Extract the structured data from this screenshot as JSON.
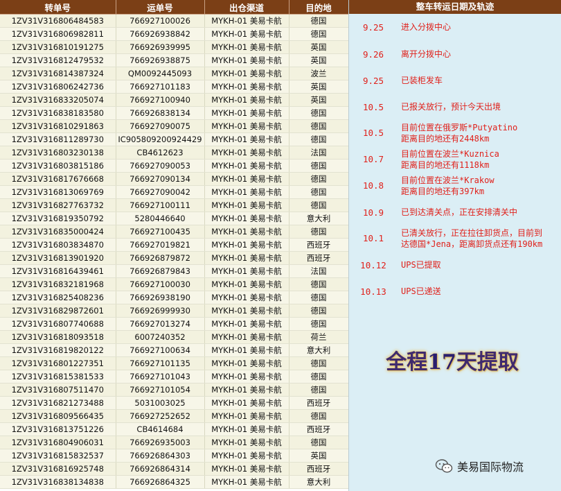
{
  "table": {
    "headers": [
      "转单号",
      "运单号",
      "出仓渠道",
      "目的地"
    ],
    "rows": [
      [
        "1ZV31V316806484583",
        "766927100026",
        "MYKH-01 美易卡航",
        "德国"
      ],
      [
        "1ZV31V316806982811",
        "766926938842",
        "MYKH-01 美易卡航",
        "德国"
      ],
      [
        "1ZV31V316810191275",
        "766926939995",
        "MYKH-01 美易卡航",
        "英国"
      ],
      [
        "1ZV31V316812479532",
        "766926938875",
        "MYKH-01 美易卡航",
        "英国"
      ],
      [
        "1ZV31V316814387324",
        "QM0092445093",
        "MYKH-01 美易卡航",
        "波兰"
      ],
      [
        "1ZV31V316806242736",
        "766927101183",
        "MYKH-01 美易卡航",
        "英国"
      ],
      [
        "1ZV31V316833205074",
        "766927100940",
        "MYKH-01 美易卡航",
        "英国"
      ],
      [
        "1ZV31V316838183580",
        "766926838134",
        "MYKH-01 美易卡航",
        "德国"
      ],
      [
        "1ZV31V316810291863",
        "766927090075",
        "MYKH-01 美易卡航",
        "德国"
      ],
      [
        "1ZV31V316811289730",
        "IC905809200924429",
        "MYKH-01 美易卡航",
        "德国"
      ],
      [
        "1ZV31V316803230138",
        "CB4612623",
        "MYKH-01 美易卡航",
        "法国"
      ],
      [
        "1ZV31V316803815186",
        "766927090053",
        "MYKH-01 美易卡航",
        "德国"
      ],
      [
        "1ZV31V316817676668",
        "766927090134",
        "MYKH-01 美易卡航",
        "德国"
      ],
      [
        "1ZV31V316813069769",
        "766927090042",
        "MYKH-01 美易卡航",
        "德国"
      ],
      [
        "1ZV31V316827763732",
        "766927100111",
        "MYKH-01 美易卡航",
        "德国"
      ],
      [
        "1ZV31V316819350792",
        "5280446640",
        "MYKH-01 美易卡航",
        "意大利"
      ],
      [
        "1ZV31V316835000424",
        "766927100435",
        "MYKH-01 美易卡航",
        "德国"
      ],
      [
        "1ZV31V316803834870",
        "766927019821",
        "MYKH-01 美易卡航",
        "西班牙"
      ],
      [
        "1ZV31V316813901920",
        "766926879872",
        "MYKH-01 美易卡航",
        "西班牙"
      ],
      [
        "1ZV31V316816439461",
        "766926879843",
        "MYKH-01 美易卡航",
        "法国"
      ],
      [
        "1ZV31V316832181968",
        "766927100030",
        "MYKH-01 美易卡航",
        "德国"
      ],
      [
        "1ZV31V316825408236",
        "766926938190",
        "MYKH-01 美易卡航",
        "德国"
      ],
      [
        "1ZV31V316829872601",
        "766926999930",
        "MYKH-01 美易卡航",
        "德国"
      ],
      [
        "1ZV31V316807740688",
        "766927013274",
        "MYKH-01 美易卡航",
        "德国"
      ],
      [
        "1ZV31V316818093518",
        "6007240352",
        "MYKH-01 美易卡航",
        "荷兰"
      ],
      [
        "1ZV31V316819820122",
        "766927100634",
        "MYKH-01 美易卡航",
        "意大利"
      ],
      [
        "1ZV31V316801227351",
        "766927101135",
        "MYKH-01 美易卡航",
        "德国"
      ],
      [
        "1ZV31V316815381533",
        "766927101043",
        "MYKH-01 美易卡航",
        "德国"
      ],
      [
        "1ZV31V316807511470",
        "766927101054",
        "MYKH-01 美易卡航",
        "德国"
      ],
      [
        "1ZV31V316821273488",
        "5031003025",
        "MYKH-01 美易卡航",
        "西班牙"
      ],
      [
        "1ZV31V316809566435",
        "766927252652",
        "MYKH-01 美易卡航",
        "德国"
      ],
      [
        "1ZV31V316813751226",
        "CB4614684",
        "MYKH-01 美易卡航",
        "西班牙"
      ],
      [
        "1ZV31V316804906031",
        "766926935003",
        "MYKH-01 美易卡航",
        "德国"
      ],
      [
        "1ZV31V316815832537",
        "766926864303",
        "MYKH-01 美易卡航",
        "英国"
      ],
      [
        "1ZV31V316816925748",
        "766926864314",
        "MYKH-01 美易卡航",
        "西班牙"
      ],
      [
        "1ZV31V316838134838",
        "766926864325",
        "MYKH-01 美易卡航",
        "意大利"
      ]
    ]
  },
  "tracking": {
    "title": "整车转运日期及轨迹",
    "events": [
      {
        "date": "9.25",
        "lines": [
          "进入分拨中心"
        ]
      },
      {
        "date": "9.26",
        "lines": [
          "离开分拨中心"
        ]
      },
      {
        "date": "9.25",
        "lines": [
          "已装柜发车"
        ]
      },
      {
        "date": "10.5",
        "lines": [
          "已报关放行，预计今天出境"
        ]
      },
      {
        "date": "10.5",
        "lines": [
          "目前位置在俄罗斯*Putyatino",
          "距离目的地还有2448km"
        ]
      },
      {
        "date": "10.7",
        "lines": [
          "目前位置在波兰*Kuznica",
          "距离目的地还有1118km"
        ]
      },
      {
        "date": "10.8",
        "lines": [
          "目前位置在波兰*Krakow",
          "距离目的地还有397km"
        ]
      },
      {
        "date": "10.9",
        "lines": [
          "已到达清关点，正在安排清关中"
        ]
      },
      {
        "date": "10.1",
        "lines": [
          "已清关放行，正在拉往卸货点，目前到",
          "达德国*Jena，距离卸货点还有190km"
        ]
      },
      {
        "date": "10.12",
        "lines": [
          "UPS已提取"
        ]
      },
      {
        "date": "10.13",
        "lines": [
          "UPS已递送"
        ]
      }
    ]
  },
  "summary": {
    "prefix": "全程",
    "number": "17",
    "suffix": "天提取"
  },
  "brand": {
    "name": "美易国际物流",
    "icon": "wechat-icon"
  }
}
